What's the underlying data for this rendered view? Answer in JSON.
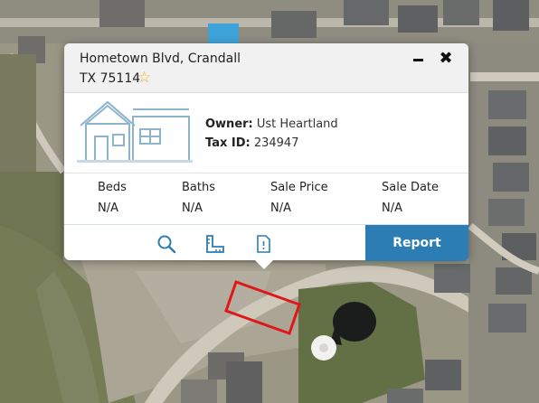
{
  "property": {
    "address_line1": "Hometown Blvd, Crandall",
    "address_line2": "TX 75114",
    "owner_label": "Owner:",
    "owner_value": "Ust Heartland",
    "tax_label": "Tax ID:",
    "tax_value": "234947"
  },
  "stats": [
    {
      "label": "Beds",
      "value": "N/A"
    },
    {
      "label": "Baths",
      "value": "N/A"
    },
    {
      "label": "Sale Price",
      "value": "N/A"
    },
    {
      "label": "Sale Date",
      "value": "N/A"
    }
  ],
  "actions": {
    "report_label": "Report",
    "icons": [
      "search-icon",
      "ruler-icon",
      "document-icon"
    ]
  },
  "header_icons": [
    "star-icon",
    "minimize-icon",
    "close-icon"
  ],
  "colors": {
    "accent": "#2b7db3",
    "star": "#e7b416",
    "parcel_outline": "#e0171a"
  }
}
